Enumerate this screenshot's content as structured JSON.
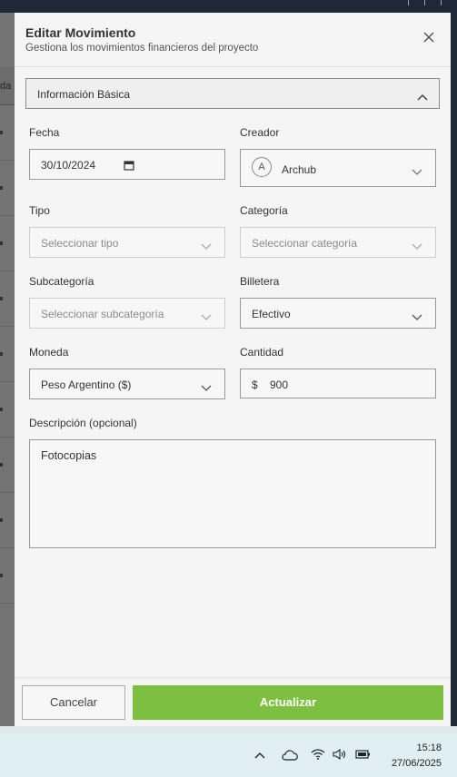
{
  "modal": {
    "title": "Editar Movimiento",
    "subtitle": "Gestiona los movimientos financieros del proyecto",
    "section": "Información Básica",
    "fields": {
      "fecha": {
        "label": "Fecha",
        "value": "30/10/2024"
      },
      "creador": {
        "label": "Creador",
        "value": "Archub",
        "avatar_initial": "A"
      },
      "tipo": {
        "label": "Tipo",
        "placeholder": "Seleccionar tipo"
      },
      "categoria": {
        "label": "Categoría",
        "placeholder": "Seleccionar categoría"
      },
      "subcategoria": {
        "label": "Subcategoría",
        "placeholder": "Seleccionar subcategoría"
      },
      "billetera": {
        "label": "Billetera",
        "value": "Efectivo"
      },
      "moneda": {
        "label": "Moneda",
        "value": "Peso Argentino ($)"
      },
      "cantidad": {
        "label": "Cantidad",
        "currency_symbol": "$",
        "value": "900"
      },
      "descripcion": {
        "label": "Descripción (opcional)",
        "value": "Fotocopias"
      }
    },
    "buttons": {
      "cancel": "Cancelar",
      "update": "Actualizar"
    }
  },
  "background": {
    "header_fragment": "da"
  },
  "taskbar": {
    "time": "15:18",
    "date": "27/06/2025"
  },
  "colors": {
    "accent": "#7dc041",
    "topbar": "#1e2836"
  }
}
